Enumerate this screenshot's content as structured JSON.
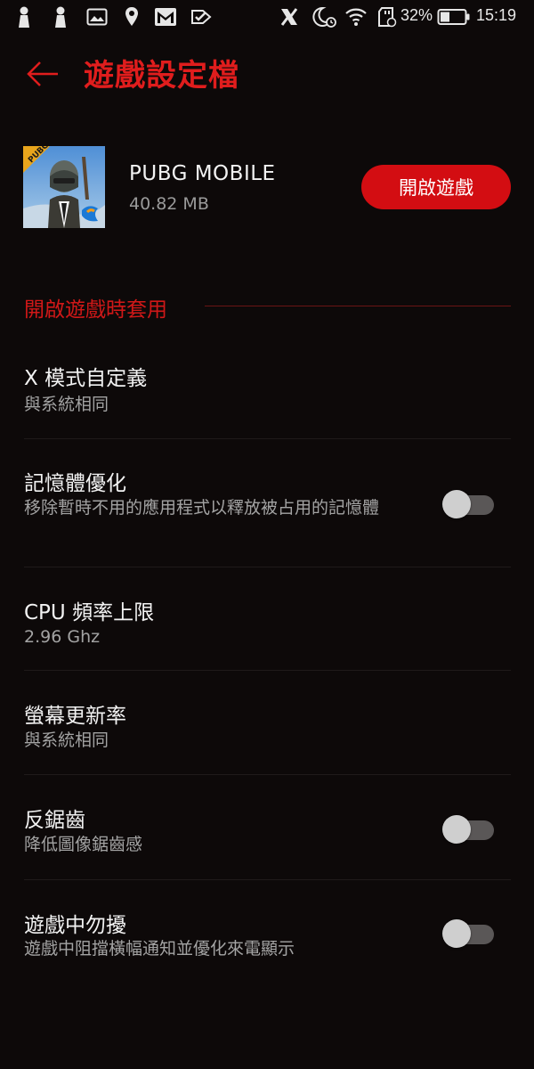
{
  "status_bar": {
    "battery_percent": "32%",
    "time": "15:19",
    "icons": [
      "person-pin-icon",
      "person-pin-icon",
      "image-icon",
      "location-icon",
      "gmail-icon",
      "checkbox-icon",
      "x-mode-icon",
      "moon-alarm-icon",
      "wifi-icon",
      "sd-card-icon",
      "battery-icon"
    ]
  },
  "header": {
    "title": "遊戲設定檔",
    "back_icon": "arrow-left-icon"
  },
  "app": {
    "name": "PUBG MOBILE",
    "size": "40.82 MB",
    "icon_badge": "PUBG",
    "launch_label": "開啟遊戲"
  },
  "section": {
    "label": "開啟遊戲時套用"
  },
  "settings": [
    {
      "title": "X 模式自定義",
      "subtitle": "與系統相同",
      "has_toggle": false
    },
    {
      "title": "記憶體優化",
      "subtitle": "移除暫時不用的應用程式以釋放被占用的記憶體",
      "has_toggle": true,
      "enabled": false
    },
    {
      "title": "CPU 頻率上限",
      "subtitle": "2.96 Ghz",
      "has_toggle": false
    },
    {
      "title": "螢幕更新率",
      "subtitle": "與系統相同",
      "has_toggle": false
    },
    {
      "title": "反鋸齒",
      "subtitle": "降低圖像鋸齒感",
      "has_toggle": true,
      "enabled": false
    },
    {
      "title": "遊戲中勿擾",
      "subtitle": "遊戲中阻擋橫幅通知並優化來電顯示",
      "has_toggle": true,
      "enabled": false
    }
  ],
  "colors": {
    "accent": "#d30d12",
    "background": "#0d0909",
    "section_label": "#d11818"
  }
}
